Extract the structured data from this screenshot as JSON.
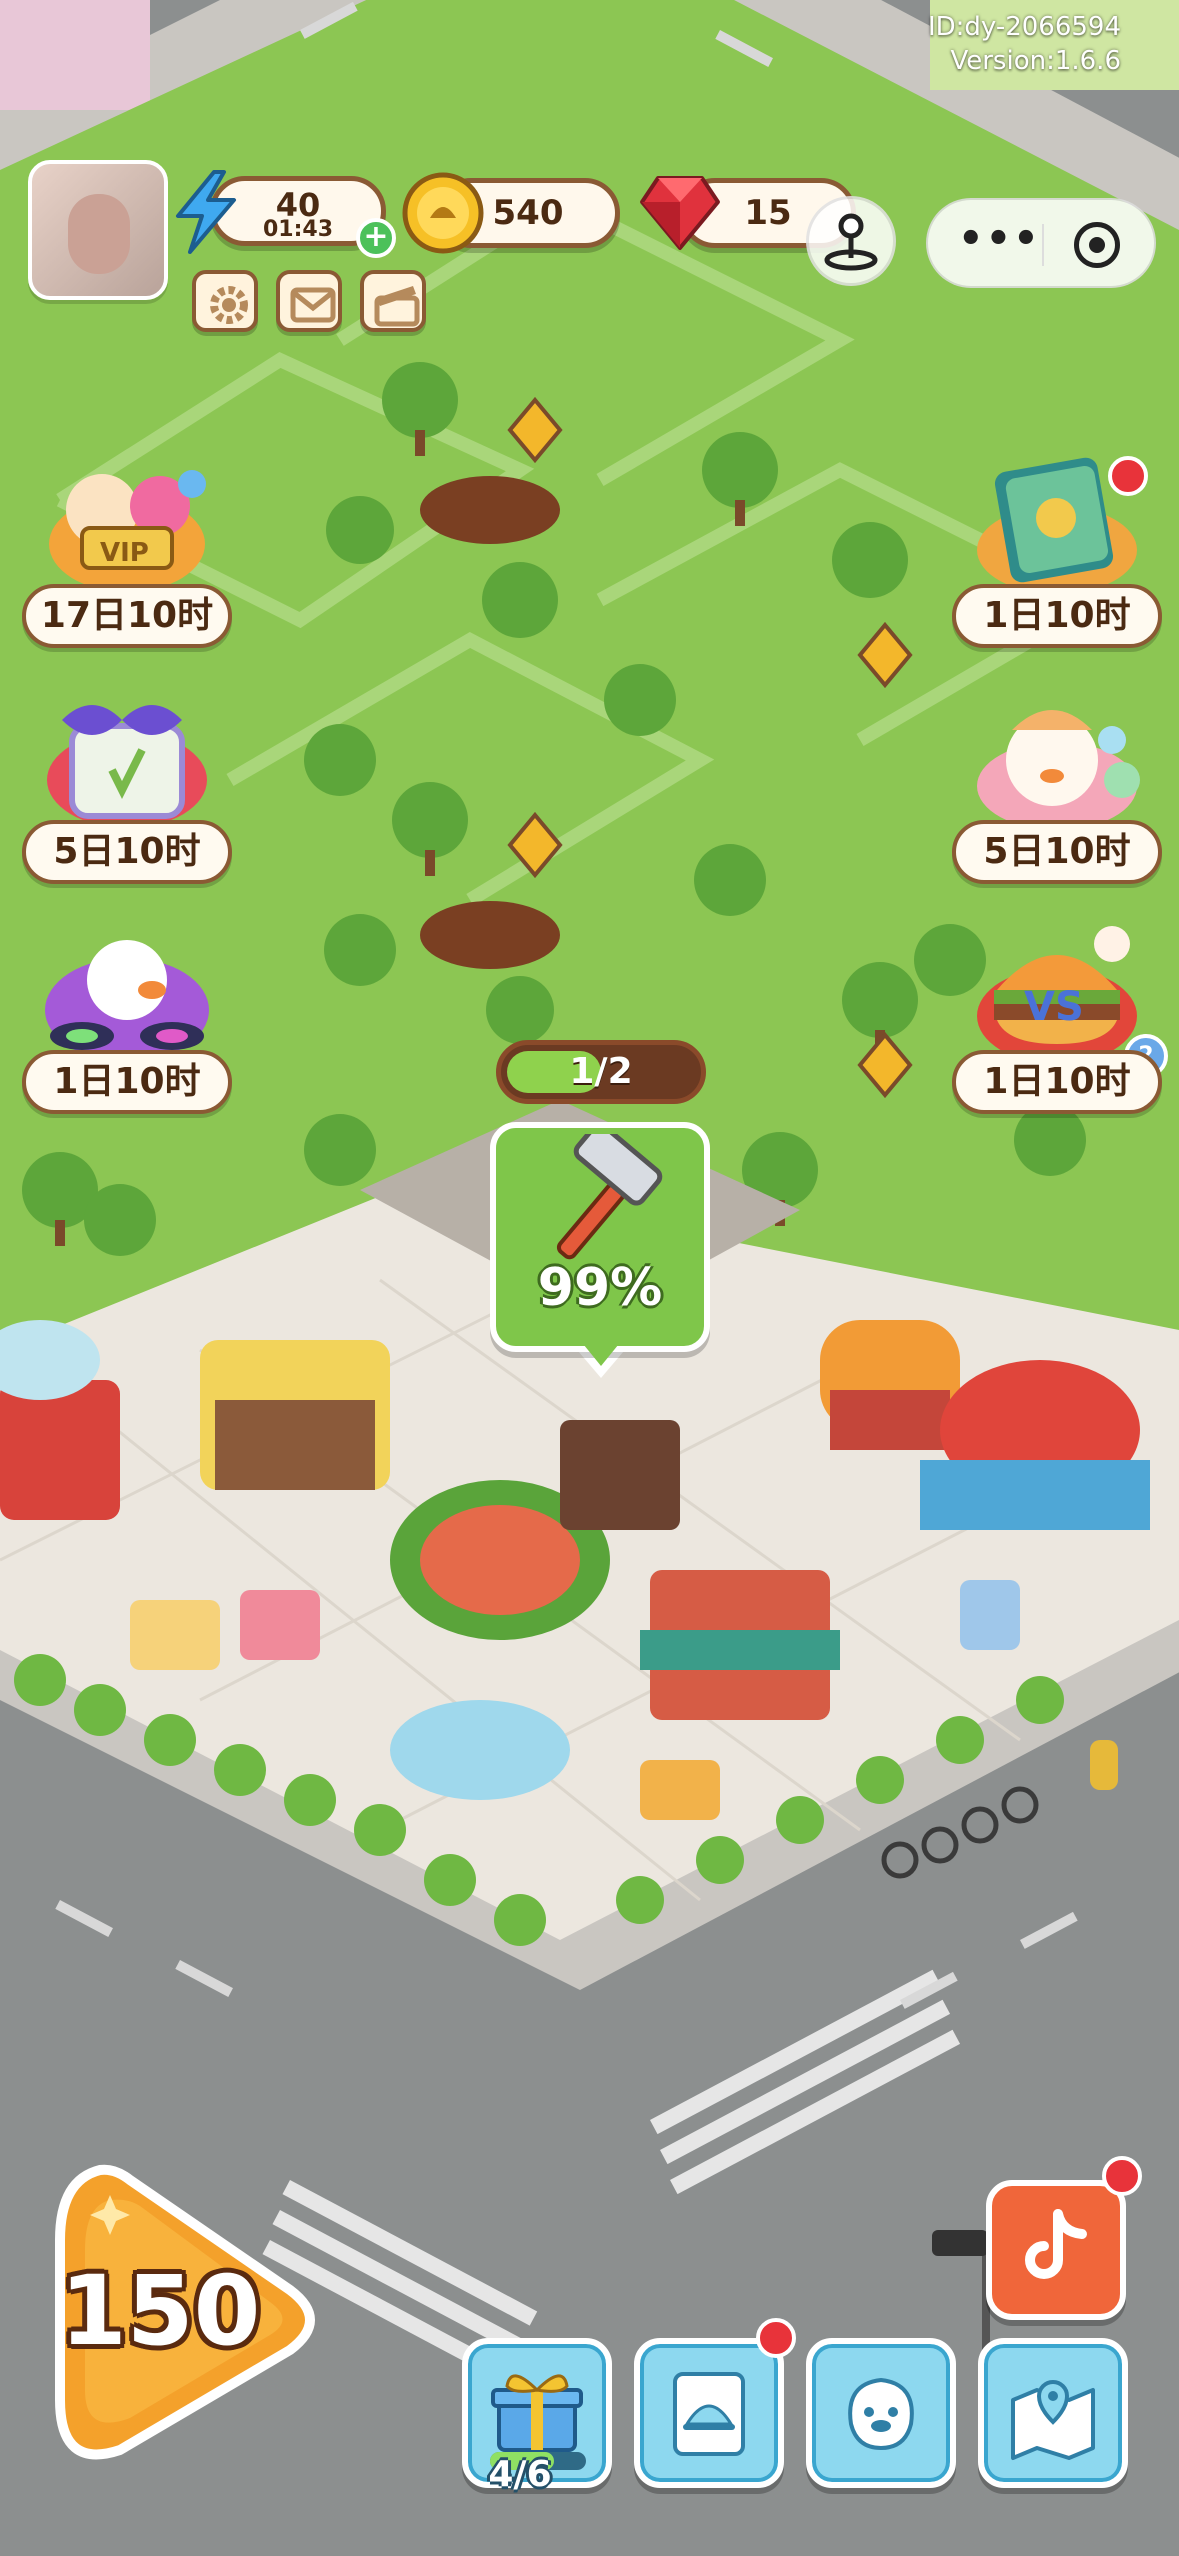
{
  "hud": {
    "id_text": "ID:dy-2066594",
    "version_text": "Version:1.6.6",
    "energy": {
      "value": "40",
      "timer": "01:43"
    },
    "coins": {
      "value": "540"
    },
    "gems": {
      "value": "15"
    },
    "plus_symbol": "+"
  },
  "events": {
    "vip": {
      "timer": "17日10时",
      "badge": "VIP"
    },
    "cake": {
      "timer": "5日10时"
    },
    "dj": {
      "timer": "1日10时"
    },
    "book": {
      "timer": "1日10时"
    },
    "duck_bath": {
      "timer": "5日10时"
    },
    "burger_vs": {
      "timer": "1日10时",
      "badge": "VS",
      "count": "2"
    }
  },
  "quest": {
    "label": "1/2",
    "progress": 0.5
  },
  "build": {
    "percent": "99%",
    "progress": 0.99
  },
  "bottom": {
    "play_value": "150",
    "gift_progress_text": "4/6",
    "gift_progress": 0.6667
  },
  "colors": {
    "grass": "#8cc653",
    "plaza": "#ece7df",
    "road": "#8c8f8f",
    "accent_orange": "#f4a12b",
    "bubble_green": "#7fc64a",
    "tile_blue": "#8dd8ef",
    "pill_border": "#8a5a34"
  },
  "icons": {
    "energy": "lightning-icon",
    "coin": "coin-icon",
    "gem": "gem-icon",
    "settings": "gear-icon",
    "mail": "mail-icon",
    "video": "clapperboard-icon",
    "map_pin": "joystick-pin-icon",
    "build": "hammer-icon",
    "gift": "gift-box-icon",
    "menu": "cloche-menu-icon",
    "pet": "duck-face-icon",
    "map": "map-pin-icon",
    "tiktok": "tiktok-icon"
  }
}
